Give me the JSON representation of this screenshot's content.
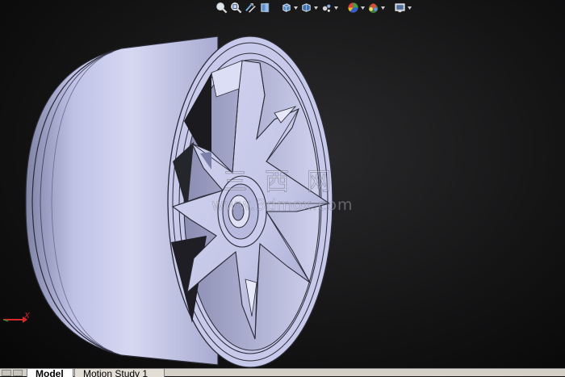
{
  "watermark": {
    "cn": "三西网",
    "url": "www.3dmox.com"
  },
  "triad": {
    "axis_label": "X"
  },
  "toolbar": {
    "buttons": [
      {
        "icon": "zoom-to-fit-icon"
      },
      {
        "icon": "zoom-to-area-icon"
      },
      {
        "icon": "previous-view-icon"
      },
      {
        "icon": "section-view-icon"
      },
      {
        "icon": "view-orientation-icon"
      },
      {
        "icon": "display-style-icon"
      },
      {
        "icon": "hide-show-items-icon"
      },
      {
        "icon": "edit-appearance-icon"
      },
      {
        "icon": "apply-scene-icon"
      },
      {
        "icon": "view-settings-icon"
      }
    ]
  },
  "tabs": [
    {
      "label": "Model",
      "active": true
    },
    {
      "label": "Motion Study 1",
      "active": false
    }
  ],
  "colors": {
    "model_face": "#c9ccec",
    "model_edge": "#2a2a35",
    "background": "#151516"
  }
}
